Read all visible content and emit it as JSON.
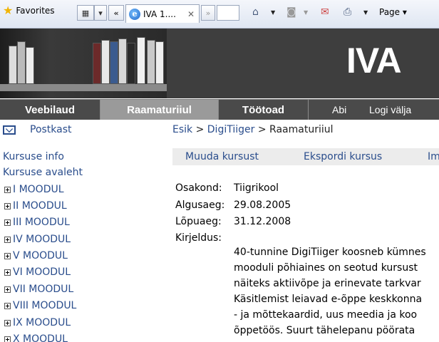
{
  "browser": {
    "favorites_label": "Favorites",
    "tab_title": "IVA 1....",
    "tab_close": "✕",
    "back_chevrons": "«",
    "forward_chevrons": "»",
    "page_menu": "Page ▾"
  },
  "header": {
    "logo_text": "IVA"
  },
  "nav": {
    "items": [
      {
        "label": "Veebilaud"
      },
      {
        "label": "Raamaturiiul"
      },
      {
        "label": "Töötoad"
      }
    ],
    "help": "Abi",
    "logout": "Logi välja"
  },
  "sidebar": {
    "mailbox": "Postkast",
    "course_info": "Kursuse info",
    "course_home": "Kursuse avaleht",
    "modules": [
      "I MOODUL",
      "II MOODUL",
      "III MOODUL",
      "IV MOODUL",
      "V MOODUL",
      "VI MOODUL",
      "VII MOODUL",
      "VIII MOODUL",
      "IX MOODUL",
      "X MOODUL"
    ]
  },
  "breadcrumb": {
    "home": "Esik",
    "sep1": ">",
    "course": "DigiTiiger",
    "sep2": ">",
    "current": "Raamaturiiul"
  },
  "actions": {
    "edit": "Muuda kursust",
    "export": "Ekspordi kursus",
    "more": "Im"
  },
  "course": {
    "department_label": "Osakond:",
    "department_value": "Tiigrikool",
    "start_label": "Algusaeg:",
    "start_value": "29.08.2005",
    "end_label": "Lõpuaeg:",
    "end_value": "31.12.2008",
    "description_label": "Kirjeldus:",
    "description_lines": [
      "40-tunnine DigiTiiger koosneb kümnes",
      "mooduli põhiaines on seotud kursust",
      "näiteks aktiivõpe ja erinevate tarkvar",
      "Käsitlemist leiavad e-õppe keskkonna",
      "- ja mõttekaardid, uus meedia ja koo",
      "õppetöös. Suurt tähelepanu pöörata"
    ]
  }
}
